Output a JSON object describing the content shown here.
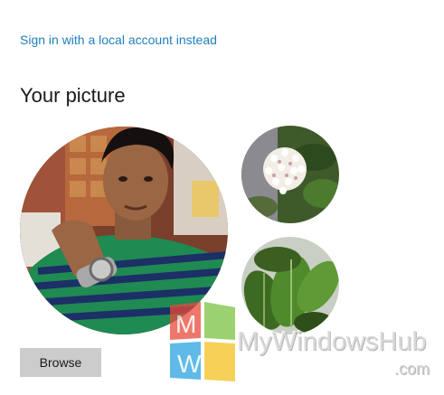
{
  "sign_in_link": "Sign in with a local account instead",
  "section_title": "Your picture",
  "pictures": {
    "current": "current-user-photo",
    "recent": [
      "recent-photo-white-flower",
      "recent-photo-green-leaves"
    ]
  },
  "browse_label": "Browse",
  "watermark": {
    "brand": "MyWindowsHub",
    "domain": ".com"
  },
  "colors": {
    "link": "#1f7fbf",
    "button_bg": "#cccccc",
    "text": "#1a1a1a"
  }
}
